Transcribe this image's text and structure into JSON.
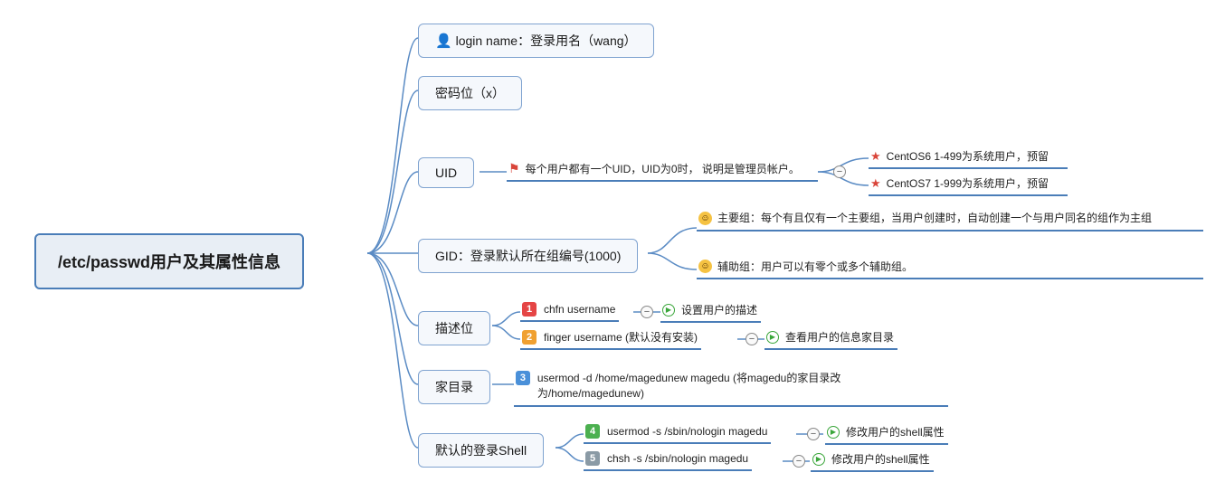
{
  "root": {
    "title": "/etc/passwd用户及其属性信息"
  },
  "children": {
    "login": {
      "label": "login name：登录用名（wang）"
    },
    "password": {
      "label": "密码位（x）"
    },
    "uid": {
      "label": "UID",
      "desc": "每个用户都有一个UID，UID为0时，  说明是管理员帐户。",
      "sub1": "CentOS6 1-499为系统用户，预留",
      "sub2": "CentOS7 1-999为系统用户，预留"
    },
    "gid": {
      "label": "GID：登录默认所在组编号(1000)",
      "sub1": "主要组：每个有且仅有一个主要组，当用户创建时，自动创建一个与用户同名的组作为主组",
      "sub2": "辅助组：用户可以有零个或多个辅助组。"
    },
    "desc": {
      "label": "描述位",
      "cmd1": "chfn username",
      "note1": "设置用户的描述",
      "cmd2": "finger username (默认没有安装)",
      "note2": "查看用户的信息家目录"
    },
    "home": {
      "label": "家目录",
      "cmd": "usermod -d /home/magedunew magedu     (将magedu的家目录改为/home/magedunew)"
    },
    "shell": {
      "label": "默认的登录Shell",
      "cmd1": "usermod -s /sbin/nologin magedu",
      "note1": "修改用户的shell属性",
      "cmd2": "chsh -s /sbin/nologin magedu",
      "note2": "修改用户的shell属性"
    }
  }
}
